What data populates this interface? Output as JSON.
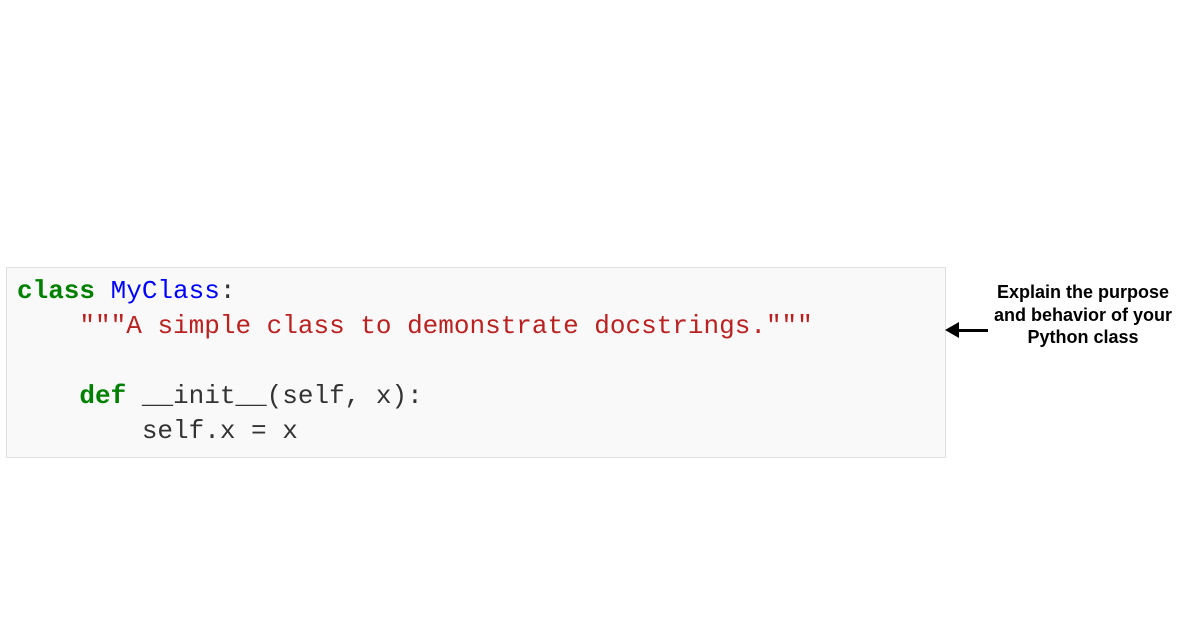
{
  "code": {
    "kw_class": "class",
    "classname": " MyClass",
    "colon1": ":",
    "indent1": "    ",
    "doc_open": "\"\"\"",
    "doc_text": "A simple class to demonstrate docstrings.",
    "doc_close": "\"\"\"",
    "blank": "",
    "kw_def": "def",
    "method_name": " __init__",
    "params": "(self, x):",
    "indent2": "        ",
    "body": "self.x = x"
  },
  "annotation": {
    "text": "Explain the purpose and behavior of your Python class"
  }
}
